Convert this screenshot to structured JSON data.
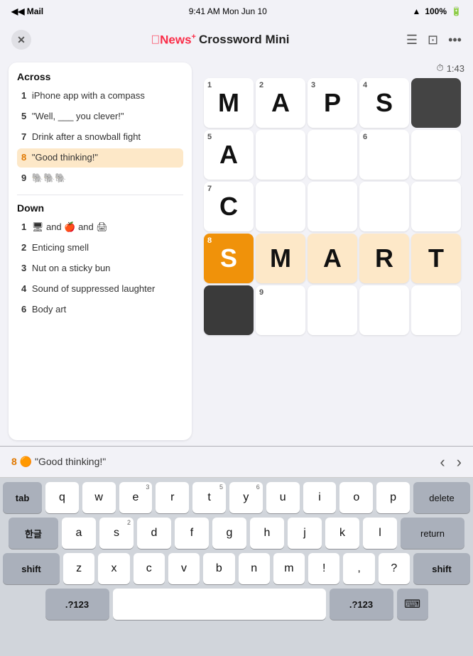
{
  "status_bar": {
    "left": "◀ Mail",
    "center": "9:41 AM  Mon Jun 10",
    "wifi": "WiFi",
    "battery": "100%"
  },
  "nav": {
    "close_label": "✕",
    "title_apple": "Apple",
    "title_news": "News+",
    "title_rest": " Crossword Mini",
    "more_icon": "•••"
  },
  "timer": {
    "label": "⏱ 1:43"
  },
  "clues": {
    "across_title": "Across",
    "across_items": [
      {
        "number": "1",
        "text": "iPhone app with a compass"
      },
      {
        "number": "5",
        "text": "\"Well, ___ you clever!\""
      },
      {
        "number": "7",
        "text": "Drink after a snowball fight"
      },
      {
        "number": "8",
        "text": "\"Good thinking!\"",
        "active": true
      },
      {
        "number": "9",
        "text": "🐘🐘🐘"
      }
    ],
    "down_title": "Down",
    "down_items": [
      {
        "number": "1",
        "text": "🖥 and 🍎 and 🖨",
        "emoji": true
      },
      {
        "number": "2",
        "text": "Enticing smell"
      },
      {
        "number": "3",
        "text": "Nut on a sticky bun"
      },
      {
        "number": "4",
        "text": "Sound of suppressed laughter"
      },
      {
        "number": "6",
        "text": "Body art"
      }
    ]
  },
  "grid": {
    "cells": [
      {
        "row": 0,
        "col": 0,
        "number": "1",
        "letter": "M",
        "state": "normal"
      },
      {
        "row": 0,
        "col": 1,
        "number": "2",
        "letter": "A",
        "state": "normal"
      },
      {
        "row": 0,
        "col": 2,
        "number": "3",
        "letter": "P",
        "state": "normal"
      },
      {
        "row": 0,
        "col": 3,
        "number": "4",
        "letter": "S",
        "state": "normal"
      },
      {
        "row": 0,
        "col": 4,
        "number": "",
        "letter": "",
        "state": "black"
      },
      {
        "row": 1,
        "col": 0,
        "number": "5",
        "letter": "A",
        "state": "normal"
      },
      {
        "row": 1,
        "col": 1,
        "number": "",
        "letter": "",
        "state": "normal"
      },
      {
        "row": 1,
        "col": 2,
        "number": "",
        "letter": "",
        "state": "normal"
      },
      {
        "row": 1,
        "col": 3,
        "number": "6",
        "letter": "",
        "state": "normal"
      },
      {
        "row": 1,
        "col": 4,
        "number": "",
        "letter": "",
        "state": "normal"
      },
      {
        "row": 2,
        "col": 0,
        "number": "7",
        "letter": "C",
        "state": "normal"
      },
      {
        "row": 2,
        "col": 1,
        "number": "",
        "letter": "",
        "state": "normal"
      },
      {
        "row": 2,
        "col": 2,
        "number": "",
        "letter": "",
        "state": "normal"
      },
      {
        "row": 2,
        "col": 3,
        "number": "",
        "letter": "",
        "state": "normal"
      },
      {
        "row": 2,
        "col": 4,
        "number": "",
        "letter": "",
        "state": "normal"
      },
      {
        "row": 3,
        "col": 0,
        "number": "8",
        "letter": "S",
        "state": "active"
      },
      {
        "row": 3,
        "col": 1,
        "number": "",
        "letter": "M",
        "state": "highlighted"
      },
      {
        "row": 3,
        "col": 2,
        "number": "",
        "letter": "A",
        "state": "highlighted"
      },
      {
        "row": 3,
        "col": 3,
        "number": "",
        "letter": "R",
        "state": "highlighted"
      },
      {
        "row": 3,
        "col": 4,
        "number": "",
        "letter": "T",
        "state": "highlighted"
      },
      {
        "row": 4,
        "col": 0,
        "number": "",
        "letter": "",
        "state": "dark-black"
      },
      {
        "row": 4,
        "col": 1,
        "number": "9",
        "letter": "",
        "state": "normal"
      },
      {
        "row": 4,
        "col": 2,
        "number": "",
        "letter": "",
        "state": "normal"
      },
      {
        "row": 4,
        "col": 3,
        "number": "",
        "letter": "",
        "state": "normal"
      },
      {
        "row": 4,
        "col": 4,
        "number": "",
        "letter": "",
        "state": "normal"
      }
    ]
  },
  "keyboard_hint": {
    "clue_number": "8",
    "clue_emoji": "🟠",
    "clue_text": " \"Good thinking!\""
  },
  "keyboard": {
    "row1": [
      "q",
      "w",
      "e",
      "r",
      "t",
      "y",
      "u",
      "i",
      "o",
      "p"
    ],
    "row1_nums": [
      "",
      "",
      "3",
      "",
      "5",
      "6",
      "",
      "",
      "",
      ""
    ],
    "row2": [
      "a",
      "s",
      "d",
      "f",
      "g",
      "h",
      "j",
      "k",
      "l"
    ],
    "row2_nums": [
      "",
      "2",
      "",
      "",
      "",
      "",
      "",
      "",
      ""
    ],
    "row3": [
      "z",
      "x",
      "c",
      "v",
      "b",
      "n",
      "m",
      "!",
      ",",
      "?"
    ],
    "row3_nums": [
      "",
      "",
      "",
      "",
      "",
      "",
      "",
      "",
      "",
      ""
    ],
    "special_left_r1": "tab",
    "special_left_r2": "한글",
    "special_left_r3": "shift",
    "special_right_r1": "delete",
    "special_right_r2": "return",
    "special_right_r3": "shift",
    "bottom_left": ".?123",
    "bottom_right": ".?123",
    "bottom_space": ""
  }
}
